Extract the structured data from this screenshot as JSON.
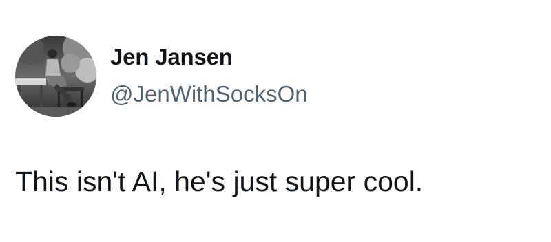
{
  "author": {
    "display_name": "Jen Jansen",
    "handle": "@JenWithSocksOn",
    "avatar_icon": "profile-photo"
  },
  "tweet": {
    "text": "This isn't AI, he's just super cool."
  },
  "colors": {
    "text_primary": "#0f1419",
    "text_secondary": "#536471",
    "background": "#ffffff"
  }
}
